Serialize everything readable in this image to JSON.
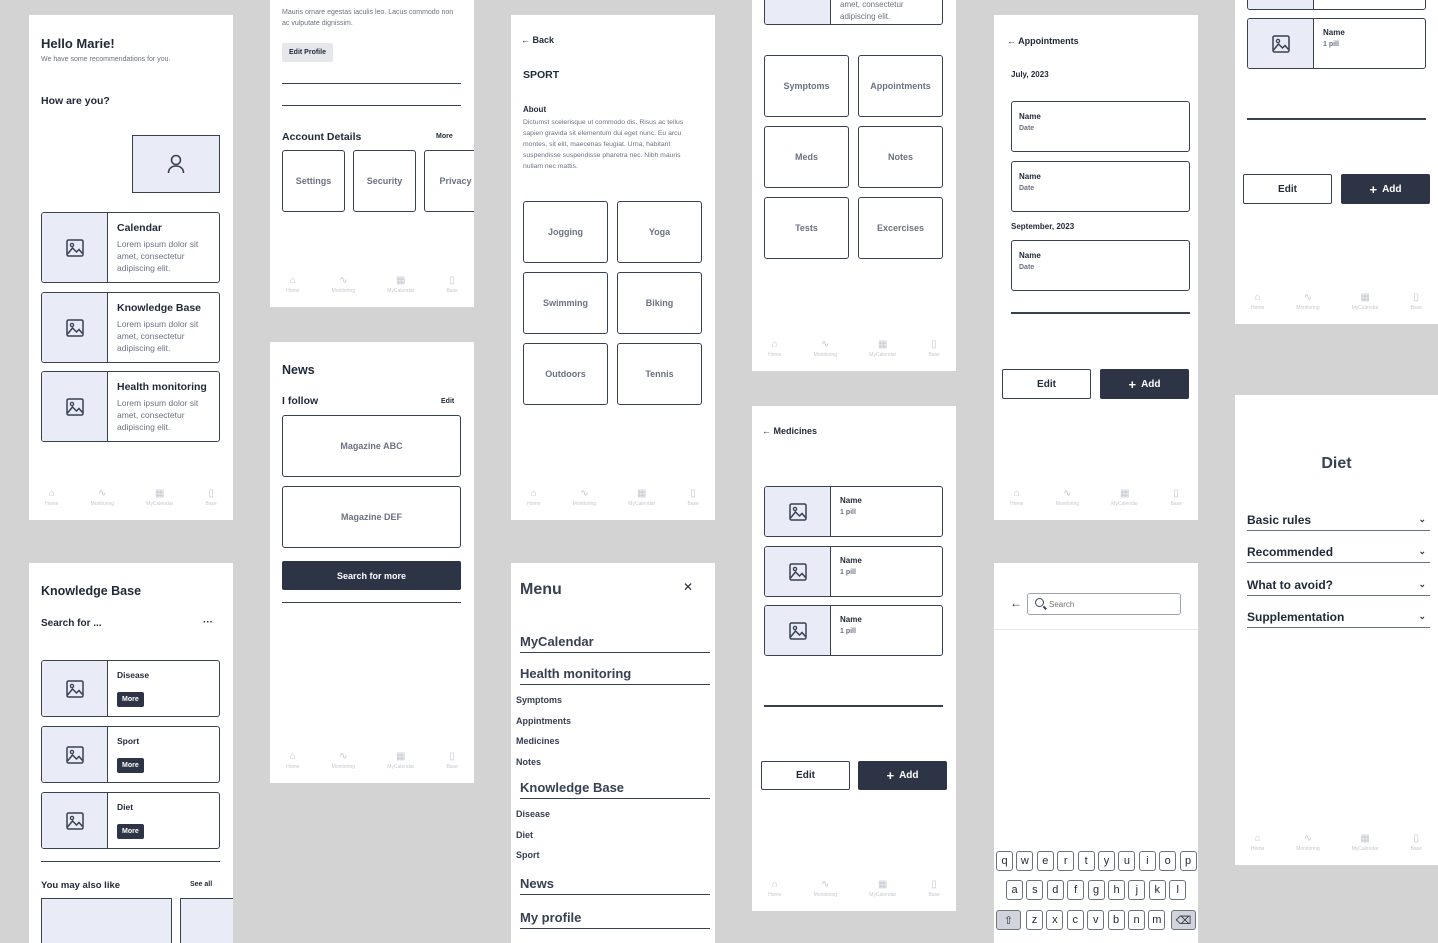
{
  "home": {
    "greeting": "Hello Marie!",
    "sub": "We have some recommendations for you.",
    "how": "How are you?",
    "cards": [
      {
        "title": "Calendar",
        "text": "Lorem ipsum dolor sit amet, consectetur adipiscing elit."
      },
      {
        "title": "Knowledge Base",
        "text": "Lorem ipsum dolor sit amet, consectetur adipiscing elit."
      },
      {
        "title": "Health monitoring",
        "text": "Lorem ipsum dolor sit amet, consectetur adipiscing elit."
      }
    ]
  },
  "nav": {
    "home": "Home",
    "monitoring": "Monitoring",
    "calendar": "MyCalendar",
    "base": "Base"
  },
  "kb": {
    "title": "Knowledge Base",
    "search": "Search for ...",
    "dots": "···",
    "items": [
      "Disease",
      "Sport",
      "Diet"
    ],
    "more": "More",
    "also": "You may also like",
    "see_all": "See all"
  },
  "profile": {
    "truncated": "Mauris ornare egestas iaculis leo. Lacus commodo non ac vulputate dignissim.",
    "edit_profile": "Edit Profile",
    "account": "Account Details",
    "more": "More",
    "tiles": [
      "Settings",
      "Security",
      "Privacy"
    ]
  },
  "news": {
    "title": "News",
    "follow": "I follow",
    "edit": "Edit",
    "mags": [
      "Magazine ABC",
      "Magazine DEF"
    ],
    "search": "Search for more"
  },
  "sport": {
    "back": "Back",
    "title": "SPORT",
    "about": "About",
    "text": "Dictumst scelerisque ut commodo dis. Risus ac tellus sapien gravida sit elementum dui eget nunc. Eu arcu montes, sit elit, maecenas feugiat. Urna, habitant suspendisse suspendisse pharetra nec. Nibh mauris nullam nec mattis.",
    "tiles": [
      "Jogging",
      "Yoga",
      "Swimming",
      "Biking",
      "Outdoors",
      "Tennis"
    ]
  },
  "menu": {
    "title": "Menu",
    "close": "✕",
    "mycal": "MyCalendar",
    "health": "Health monitoring",
    "health_items": [
      "Symptoms",
      "Appintments",
      "Medicines",
      "Notes"
    ],
    "kb": "Knowledge Base",
    "kb_items": [
      "Disease",
      "Diet",
      "Sport"
    ],
    "news": "News",
    "profile": "My profile"
  },
  "monitor": {
    "top": "amet, consectetur adipiscing elit.",
    "tiles": [
      "Symptoms",
      "Appointments",
      "Meds",
      "Notes",
      "Tests",
      "Excercises"
    ]
  },
  "meds": {
    "title": "Medicines",
    "items": [
      {
        "name": "Name",
        "dose": "1 pill"
      },
      {
        "name": "Name",
        "dose": "1 pill"
      },
      {
        "name": "Name",
        "dose": "1 pill"
      }
    ],
    "edit": "Edit",
    "add": "Add"
  },
  "appt": {
    "title": "Appointments",
    "m1": "July, 2023",
    "m2": "September, 2023",
    "items": [
      {
        "name": "Name",
        "date": "Date"
      },
      {
        "name": "Name",
        "date": "Date"
      },
      {
        "name": "Name",
        "date": "Date"
      }
    ],
    "edit": "Edit",
    "add": "Add"
  },
  "search": {
    "placeholder": "Search",
    "row1": [
      "q",
      "w",
      "e",
      "r",
      "t",
      "y",
      "u",
      "i",
      "o",
      "p"
    ],
    "row2": [
      "a",
      "s",
      "d",
      "f",
      "g",
      "h",
      "j",
      "k",
      "l"
    ],
    "row3": [
      "z",
      "x",
      "c",
      "v",
      "b",
      "n",
      "m"
    ]
  },
  "pills": {
    "name": "Name",
    "dose": "1 pill",
    "edit": "Edit",
    "add": "Add"
  },
  "diet": {
    "title": "Diet",
    "items": [
      "Basic rules",
      "Recommended",
      "What to avoid?",
      "Supplementation"
    ]
  }
}
